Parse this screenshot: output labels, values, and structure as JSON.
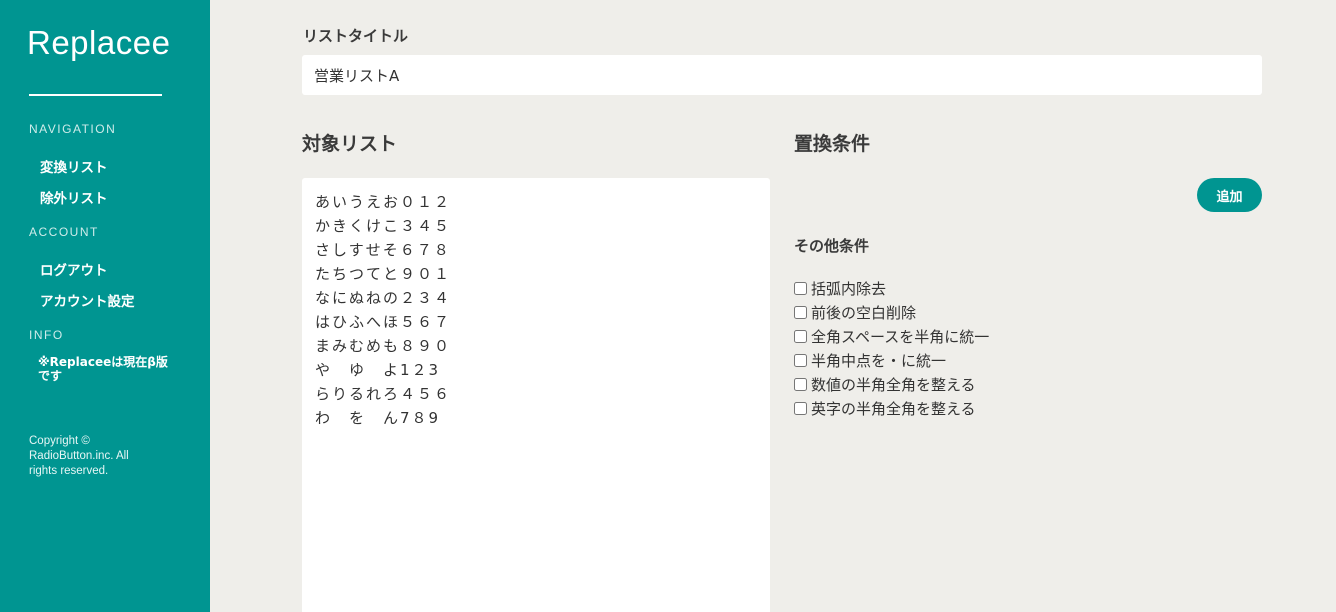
{
  "sidebar": {
    "logo": "Replacee",
    "navigation_heading": "NAVIGATION",
    "nav_items": [
      "変換リスト",
      "除外リスト"
    ],
    "account_heading": "ACCOUNT",
    "account_items": [
      "ログアウト",
      "アカウント設定"
    ],
    "info_heading": "INFO",
    "info_text": "※Replaceeは現在β版です",
    "copyright": "Copyright © RadioButton.inc. All rights reserved."
  },
  "form": {
    "list_title_label": "リストタイトル",
    "list_title_value": "営業リストA",
    "target_list_heading": "対象リスト",
    "target_list_value": "あいうえお０１２\nかきくけこ３４５\nさしすせそ６７８\nたちつてと９０１\nなにぬねの２３４\nはひふへほ５６７\nまみむめも８９０\nや　ゆ　よ1２3\nらりるれろ４５６\nわ　を　ん7８9",
    "replace_conditions_heading": "置換条件",
    "add_button": "追加",
    "other_conditions_heading": "その他条件",
    "options": [
      {
        "label": "括弧内除去",
        "checked": false
      },
      {
        "label": "前後の空白削除",
        "checked": false
      },
      {
        "label": "全角スペースを半角に統一",
        "checked": false
      },
      {
        "label": "半角中点を・に統一",
        "checked": false
      },
      {
        "label": "数値の半角全角を整える",
        "checked": false
      },
      {
        "label": "英字の半角全角を整える",
        "checked": false
      }
    ]
  },
  "colors": {
    "sidebar": "#009591",
    "background": "#efeeea",
    "accent": "#009591"
  }
}
